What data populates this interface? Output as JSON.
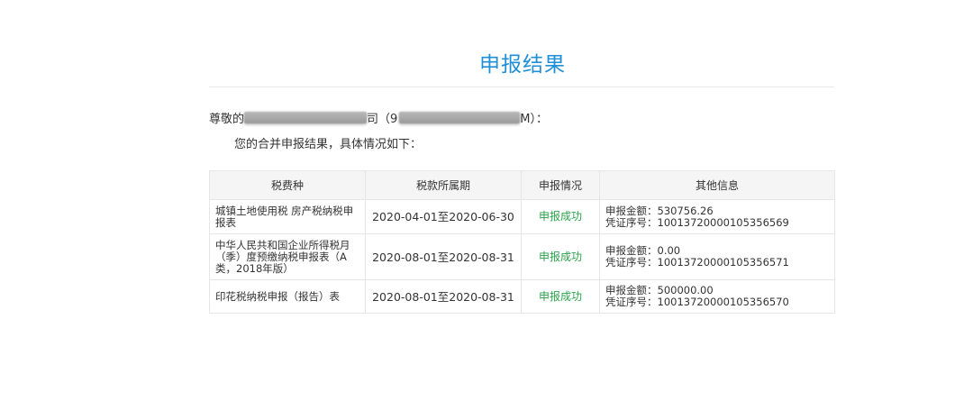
{
  "page": {
    "title": "申报结果"
  },
  "greeting": {
    "prefix": "尊敬的",
    "company_suffix": "司（9",
    "tax_id_suffix": "M）："
  },
  "intro": "您的合并申报结果，具体情况如下：",
  "table": {
    "headers": [
      "税费种",
      "税款所属期",
      "申报情况",
      "其他信息"
    ],
    "rows": [
      {
        "tax_type": "城镇土地使用税 房产税纳税申报表",
        "period": "2020-04-01至2020-06-30",
        "status": "申报成功",
        "amount_label": "申报金额：530756.26",
        "voucher_label": "凭证序号：10013720000105356569"
      },
      {
        "tax_type": "中华人民共和国企业所得税月（季）度预缴纳税申报表（A类，2018年版）",
        "period": "2020-08-01至2020-08-31",
        "status": "申报成功",
        "amount_label": "申报金额：0.00",
        "voucher_label": "凭证序号：10013720000105356571"
      },
      {
        "tax_type": "印花税纳税申报（报告）表",
        "period": "2020-08-01至2020-08-31",
        "status": "申报成功",
        "amount_label": "申报金额：500000.00",
        "voucher_label": "凭证序号：10013720000105356570"
      }
    ]
  },
  "colors": {
    "title": "#1f8fd8",
    "success": "#2aa34a",
    "header_bg": "#f5f5f5",
    "border": "#e6e6e6"
  }
}
